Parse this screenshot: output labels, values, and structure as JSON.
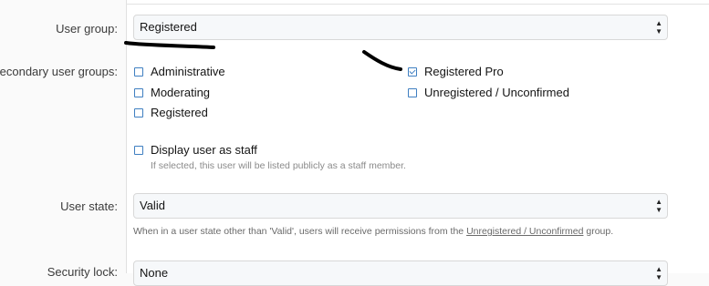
{
  "user_group": {
    "label": "User group:",
    "value": "Registered"
  },
  "secondary_groups": {
    "label": "Secondary user groups:",
    "options": [
      {
        "label": "Administrative",
        "checked": false
      },
      {
        "label": "Moderating",
        "checked": false
      },
      {
        "label": "Registered",
        "checked": false
      },
      {
        "label": "Registered Pro",
        "checked": true
      },
      {
        "label": "Unregistered / Unconfirmed",
        "checked": false
      }
    ]
  },
  "display_staff": {
    "label": "Display user as staff",
    "checked": false,
    "hint": "If selected, this user will be listed publicly as a staff member."
  },
  "user_state": {
    "label": "User state:",
    "value": "Valid",
    "hint_before": "When in a user state other than 'Valid', users will receive permissions from the",
    "hint_link": "Unregistered / Unconfirmed",
    "hint_after": "group."
  },
  "security_lock": {
    "label": "Security lock:",
    "value": "None"
  },
  "colors": {
    "checkbox_accent": "#3f7fc1",
    "input_background": "#f6f8fa",
    "annotation_ink": "#000000"
  },
  "icons": {
    "select_arrows": "updown-arrows-icon",
    "checkmark": "checkmark-icon"
  }
}
